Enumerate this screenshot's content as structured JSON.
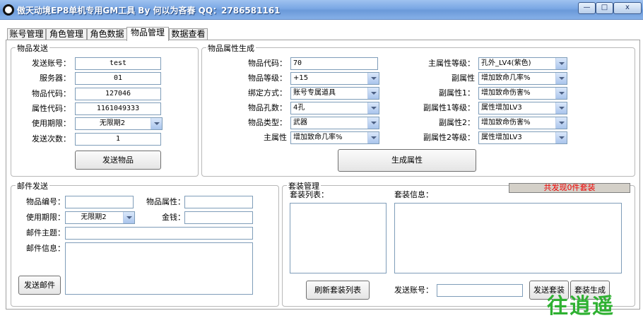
{
  "window": {
    "title": "傲天动境EP8单机专用GM工具 By 何以为吝春 QQ：2786581161",
    "min_symbol": "—",
    "max_symbol": "□",
    "close_symbol": "x"
  },
  "tabs": [
    "账号管理",
    "角色管理",
    "角色数据",
    "物品管理",
    "数据查看"
  ],
  "item_send": {
    "title": "物品发送",
    "account_label": "发送账号：",
    "account_value": "test",
    "server_label": "服务器：",
    "server_value": "01",
    "item_code_label": "物品代码：",
    "item_code_value": "127046",
    "attr_code_label": "属性代码：",
    "attr_code_value": "1161049333",
    "expiry_label": "使用期限：",
    "expiry_value": "无限期2",
    "count_label": "发送次数：",
    "count_value": "1",
    "send_button": "发送物品"
  },
  "attr_gen": {
    "title": "物品属性生成",
    "item_code_label": "物品代码：",
    "item_code_value": "70",
    "item_level_label": "物品等级：",
    "item_level_value": "+15",
    "bind_label": "绑定方式：",
    "bind_value": "账号专属道具",
    "holes_label": "物品孔数：",
    "holes_value": "4孔",
    "type_label": "物品类型：",
    "type_value": "武器",
    "main_attr_label": "主属性",
    "main_attr_value": "增加致命几率%",
    "main_level_label": "主属性等级：",
    "main_level_value": "孔外_LV4(紫色)",
    "sub_attr_label": "副属性",
    "sub_attr_value": "增加致命几率%",
    "sub1_label": "副属性1：",
    "sub1_value": "增加致命伤害%",
    "sub1_level_label": "副属性1等级：",
    "sub1_level_value": "属性增加LV3",
    "sub2_label": "副属性2：",
    "sub2_value": "增加致命伤害%",
    "sub2_level_label": "副属性2等级：",
    "sub2_level_value": "属性增加LV3",
    "generate_button": "生成属性"
  },
  "mail": {
    "title": "邮件发送",
    "item_no_label": "物品编号：",
    "item_no_value": "",
    "item_attr_label": "物品属性：",
    "item_attr_value": "",
    "expiry_label": "使用期限：",
    "expiry_value": "无限期2",
    "money_label": "金钱：",
    "money_value": "",
    "subject_label": "邮件主题：",
    "subject_value": "",
    "body_label": "邮件信息：",
    "body_value": "",
    "send_button": "发送邮件"
  },
  "suit": {
    "title": "套装管理",
    "status": "共发现0件套装",
    "list_label": "套装列表：",
    "info_label": "套装信息：",
    "refresh_button": "刷新套装列表",
    "account_label": "发送账号：",
    "account_value": "",
    "send_button": "发送套装",
    "generate_button": "套装生成"
  },
  "watermark": "往逍遥",
  "colors": {
    "status_text": "#ee0000",
    "title_bar": "#7aa7e4",
    "watermark": "#2fb132"
  }
}
